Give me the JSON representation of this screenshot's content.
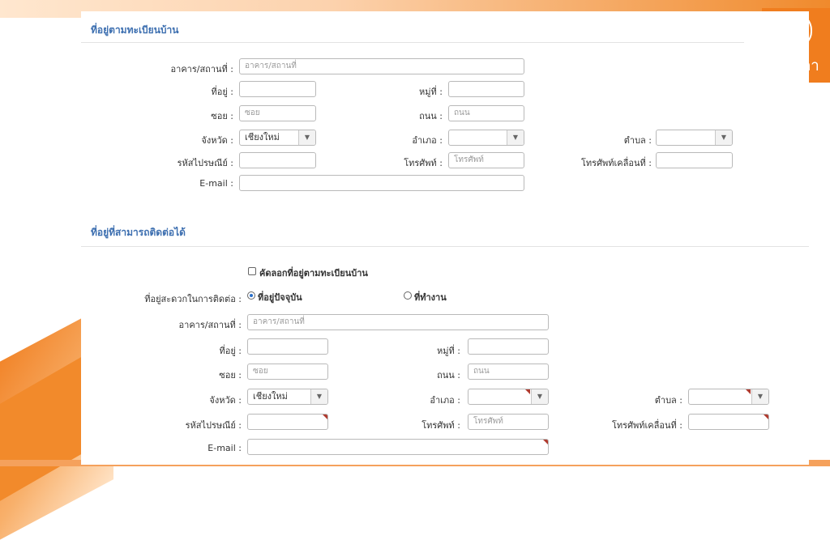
{
  "brand": {
    "logo_text": "คุรุสภา"
  },
  "registered_address": {
    "title": "ที่อยู่ตามทะเบียนบ้าน",
    "building_label": "อาคาร/สถานที่ :",
    "building_placeholder": "อาคาร/สถานที่",
    "address_label": "ที่อยู่ :",
    "moo_label": "หมู่ที่ :",
    "soi_label": "ซอย :",
    "soi_placeholder": "ซอย",
    "road_label": "ถนน :",
    "road_placeholder": "ถนน",
    "province_label": "จังหวัด :",
    "province_value": "เชียงใหม่",
    "district_label": "อำเภอ :",
    "subdistrict_label": "ตำบล :",
    "postcode_label": "รหัสไปรษณีย์ :",
    "phone_label": "โทรศัพท์ :",
    "phone_placeholder": "โทรศัพท์",
    "mobile_label": "โทรศัพท์เคลื่อนที่ :",
    "email_label": "E-mail :"
  },
  "contact_address": {
    "title": "ที่อยู่ที่สามารถติดต่อได้",
    "copy_label": "คัดลอกที่อยู่ตามทะเบียนบ้าน",
    "convenient_label": "ที่อยู่สะดวกในการติดต่อ :",
    "option_current": "ที่อยู่ปัจจุบัน",
    "option_work": "ที่ทำงาน",
    "building_label": "อาคาร/สถานที่ :",
    "building_placeholder": "อาคาร/สถานที่",
    "address_label": "ที่อยู่ :",
    "moo_label": "หมู่ที่ :",
    "soi_label": "ซอย :",
    "soi_placeholder": "ซอย",
    "road_label": "ถนน :",
    "road_placeholder": "ถนน",
    "province_label": "จังหวัด :",
    "province_value": "เชียงใหม่",
    "district_label": "อำเภอ :",
    "subdistrict_label": "ตำบล :",
    "postcode_label": "รหัสไปรษณีย์ :",
    "phone_label": "โทรศัพท์ :",
    "phone_placeholder": "โทรศัพท์",
    "mobile_label": "โทรศัพท์เคลื่อนที่ :",
    "email_label": "E-mail :"
  },
  "icons": {
    "dropdown": "chevron-down-icon",
    "logo": "emblem-icon"
  },
  "colors": {
    "accent": "#f07d1e",
    "section_title": "#3d6fb0",
    "required_mark": "#b03a2e"
  }
}
